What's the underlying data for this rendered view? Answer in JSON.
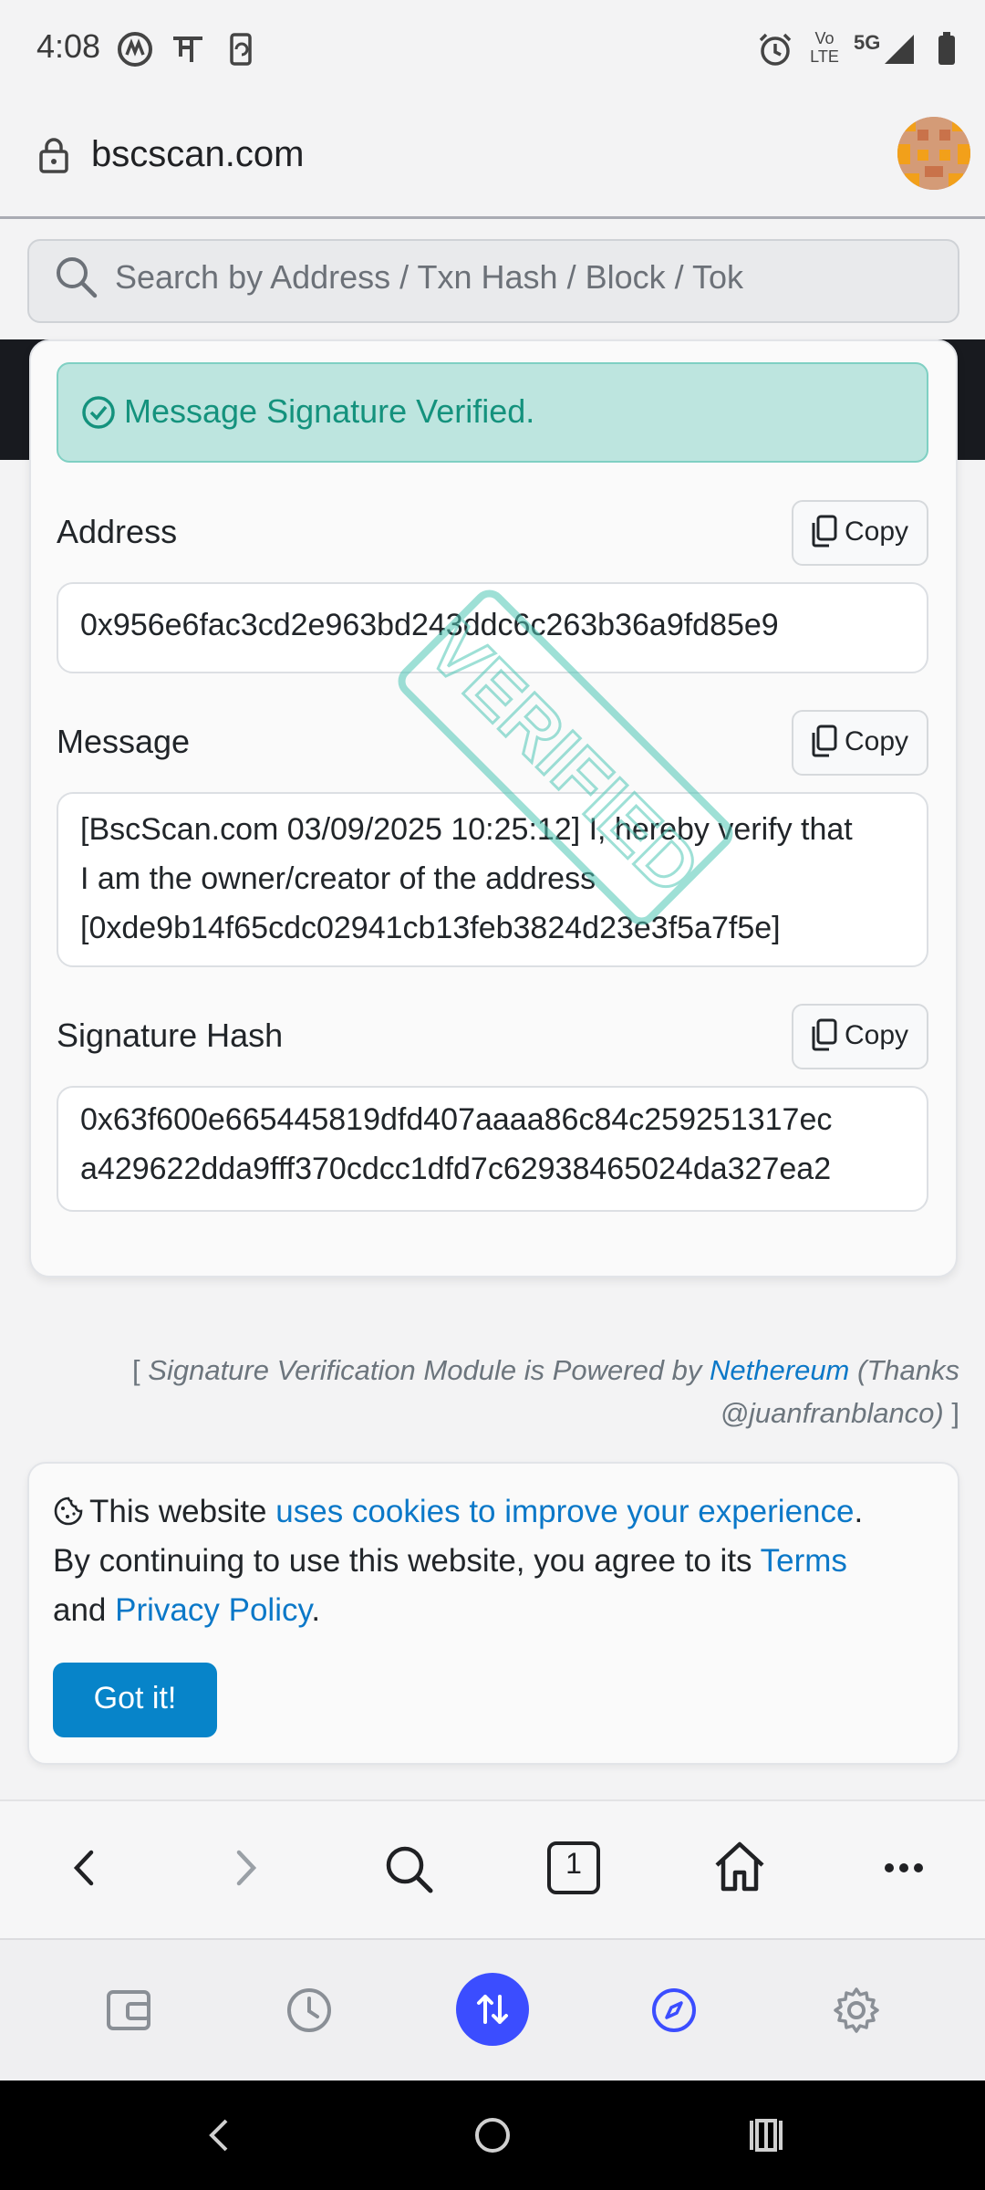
{
  "status_bar": {
    "time": "4:08",
    "network_label": "5G",
    "volte_label": "Vo LTE",
    "left_icons": [
      "app-icon",
      "hindi-char-icon",
      "phone-sync-icon"
    ],
    "right_icons": [
      "alarm-icon",
      "signal-icon",
      "battery-icon"
    ]
  },
  "browser": {
    "url": "bscscan.com",
    "search_placeholder": "Search by Address / Txn Hash / Block / Tok"
  },
  "verification": {
    "banner": "Message Signature Verified.",
    "stamp": "VERIFIED",
    "copy_label": "Copy",
    "fields": {
      "address_label": "Address",
      "address_value": "0x956e6fac3cd2e963bd243ddc6c263b36a9fd85e9",
      "message_label": "Message",
      "message_line1": "[BscScan.com 03/09/2025 10:25:12] I, hereby verify that",
      "message_line2": "I am the owner/creator of the address",
      "message_line3": "[0xde9b14f65cdc02941cb13feb3824d23e3f5a7f5e]",
      "signature_label": "Signature Hash",
      "signature_line1": "0x63f600e665445819dfd407aaaa86c84c259251317ec",
      "signature_line2": "a429622dda9fff370cdcc1dfd7c62938465024da327ea2"
    },
    "footer": {
      "open_bracket": "[",
      "pre": "Signature Verification Module is Powered by",
      "link": "Nethereum",
      "post": "(Thanks",
      "line2": "@juanfranblanco)",
      "close_bracket": "]"
    }
  },
  "cookie_notice": {
    "text1": "This website",
    "link1": "uses cookies to improve your experience",
    "text2": ".",
    "text3": "By continuing to use this website, you agree to its",
    "link2": "Terms",
    "text4": "and",
    "link3": "Privacy Policy",
    "text5": ".",
    "button": "Got it!"
  },
  "nav_bar": {
    "tab_count": "1"
  },
  "colors": {
    "accent": "#0784c9",
    "verified_green": "#14927d",
    "verified_bg": "#bde5df",
    "active_tab": "#3b4dff"
  }
}
